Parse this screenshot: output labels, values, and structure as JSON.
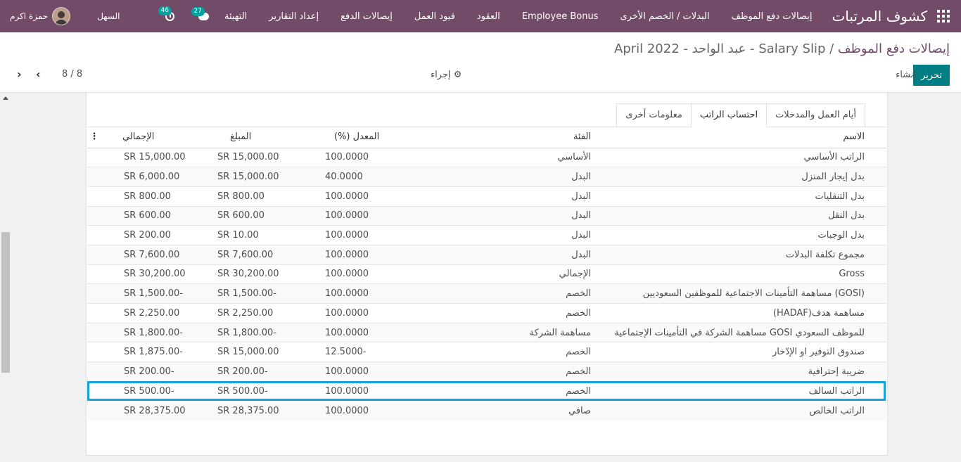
{
  "navbar": {
    "brand": "كشوف المرتبات",
    "menu": [
      "إيصالات دفع الموظف",
      "البدلات / الخصم الأخرى",
      "Employee Bonus",
      "العقود",
      "قيود العمل",
      "إيصالات الدفع",
      "إعداد التقارير",
      "التهيئة"
    ],
    "company": "السهل",
    "user_name": "حمزة اكرم",
    "activity_count": "46",
    "message_count": "27"
  },
  "control_panel": {
    "breadcrumb_link": "إيصالات دفع الموظف",
    "breadcrumb_sep": " / ",
    "breadcrumb_current": "Salary Slip - عبد الواحد - April 2022",
    "edit_label": "تحرير",
    "create_label": "إنشاء",
    "action_label": "إجراء",
    "pager": "8 / 8"
  },
  "tabs": [
    "أيام العمل والمدخلات",
    "احتساب الراتب",
    "معلومات أخرى"
  ],
  "active_tab": 1,
  "table": {
    "headers": {
      "name": "الاسم",
      "category": "الفئة",
      "rate": "المعدل (%)",
      "amount": "المبلغ",
      "total": "الإجمالي"
    },
    "rows": [
      {
        "name": "الراتب الأساسي",
        "category": "الأساسي",
        "rate": "100.0000",
        "amount": "SR 15,000.00",
        "total": "SR 15,000.00"
      },
      {
        "name": "بدل إيجار المنزل",
        "category": "البدل",
        "rate": "40.0000",
        "amount": "SR 15,000.00",
        "total": "SR 6,000.00"
      },
      {
        "name": "بدل التنقليات",
        "category": "البدل",
        "rate": "100.0000",
        "amount": "SR 800.00",
        "total": "SR 800.00"
      },
      {
        "name": "بدل النقل",
        "category": "البدل",
        "rate": "100.0000",
        "amount": "SR 600.00",
        "total": "SR 600.00"
      },
      {
        "name": "بدل الوجبات",
        "category": "البدل",
        "rate": "100.0000",
        "amount": "SR 10.00",
        "total": "SR 200.00"
      },
      {
        "name": "مجموع تكلفة البدلات",
        "category": "البدل",
        "rate": "100.0000",
        "amount": "SR 7,600.00",
        "total": "SR 7,600.00"
      },
      {
        "name": "Gross",
        "category": "الإجمالي",
        "rate": "100.0000",
        "amount": "SR 30,200.00",
        "total": "SR 30,200.00"
      },
      {
        "name": "(GOSI) مساهمة التأمينات الاجتماعية للموظفين السعوديين",
        "category": "الخصم",
        "rate": "100.0000",
        "amount": "SR 1,500.00-",
        "total": "SR 1,500.00-"
      },
      {
        "name": "مساهمة هدف(HADAF)",
        "category": "الخصم",
        "rate": "100.0000",
        "amount": "SR 2,250.00",
        "total": "SR 2,250.00"
      },
      {
        "name": "للموظف السعودي GOSI مساهمة الشركة في التأمينات الإجتماعية",
        "category": "مساهمة الشركة",
        "rate": "100.0000",
        "amount": "SR 1,800.00-",
        "total": "SR 1,800.00-"
      },
      {
        "name": "صندوق التوفير او الإدّخار",
        "category": "الخصم",
        "rate": "12.5000-",
        "amount": "SR 15,000.00",
        "total": "SR 1,875.00-"
      },
      {
        "name": "ضريبة إحترافية",
        "category": "الخصم",
        "rate": "100.0000",
        "amount": "SR 200.00-",
        "total": "SR 200.00-"
      },
      {
        "name": "الراتب السالف",
        "category": "الخصم",
        "rate": "100.0000",
        "amount": "SR 500.00-",
        "total": "SR 500.00-"
      },
      {
        "name": "الراتب الخالص",
        "category": "صافي",
        "rate": "100.0000",
        "amount": "SR 28,375.00",
        "total": "SR 28,375.00"
      }
    ]
  },
  "highlighted_row": 12,
  "colors": {
    "navbar": "#714b67",
    "primary_button": "#017e84",
    "highlight": "#1aa3d9"
  }
}
